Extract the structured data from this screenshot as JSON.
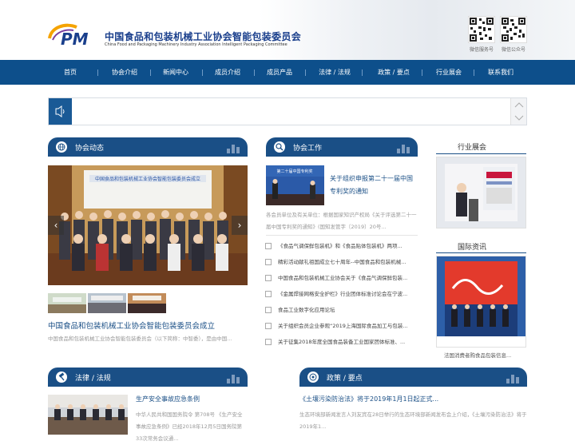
{
  "header": {
    "title": "中国食品和包装机械工业协会智能包装委员会",
    "subtitle": "China Food and Packaging Machinery Industry Association Intelligent Packaging Committee",
    "qr_captions": [
      "微信服务号",
      "微信公众号"
    ]
  },
  "nav": {
    "items": [
      "首页",
      "协会介绍",
      "新闻中心",
      "成员介绍",
      "成员产品",
      "法律 / 法规",
      "政策 / 要点",
      "行业展会",
      "联系我们"
    ]
  },
  "sections": {
    "association_news": "协会动态",
    "association_work": "协会工作",
    "exhibitions": "行业展会",
    "international": "国际资讯",
    "laws": "法律 / 法规",
    "policy": "政策 / 要点"
  },
  "news": {
    "banner_text": "中国食品和包装机械工业协会智能包装委员会成立",
    "headline": "中国食品和包装机械工业协会智能包装委员会成立",
    "summary": "中国食品和包装机械工业协会智能包装委员会（以下简称：中智委），是由中国..."
  },
  "work": {
    "thumb_text": "第二十届中国专利奖",
    "featured_title": "关于组织申报第二十一届中国专利奖的通知",
    "featured_summary": "各会员单位及有关单位：根据国家知识产权局《关于评选第二十一届中国专利奖的通知》(国知发管字〔2019〕20号...",
    "items": [
      "《食品气调保鲜包装机》和《食品贴体包装机》两项...",
      "精彩活动献礼祖国成立七十周年--中国食品和包装机械...",
      "中国食品和包装机械工业协会关于《食品气调保鲜包装...",
      "《金属焊接网格安全护栏》行业团体标准讨论会在宁波...",
      "食品工业数字化应用论坛",
      "关于组织会员企业参观“2019上海国际食品加工与包装...",
      "关于征集2018年度全国食品装备工业国家团体标准、..."
    ]
  },
  "international_caption": "法国消费者购食品包装信息...",
  "laws": {
    "title": "生产安全事故应急条例",
    "summary": "中华人民共和国国务院令 第708号 《生产安全事故应急条例》已经2018年12月5日国务院第33次常务会议通..."
  },
  "policy": {
    "title": "《土壤污染防治法》将于2019年1月1日起正式...",
    "summary": "生态环境部新闻发言人刘友宾在28日举行的生态环境部新闻发布会上介绍，《土壤污染防治法》将于2019年1..."
  },
  "colors": {
    "nav": "#0d4f8b",
    "section_header": "#1a4f86",
    "logo_orange": "#f5a300",
    "logo_blue": "#1a3f8c"
  }
}
